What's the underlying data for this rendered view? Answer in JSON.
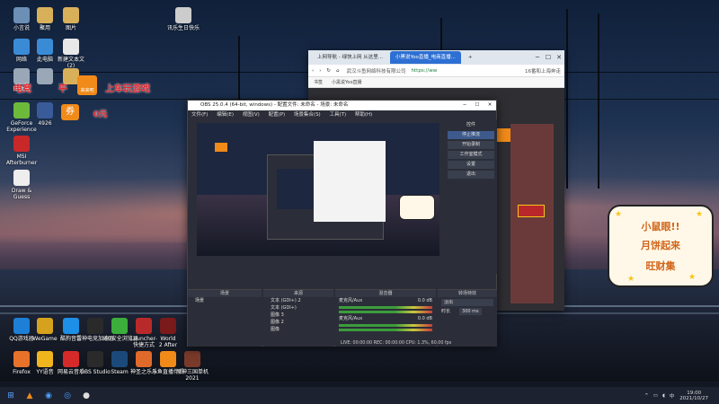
{
  "desktop": {
    "icons": [
      {
        "label": "小言说",
        "color": "#6b8fb5"
      },
      {
        "label": "聚用",
        "color": "#d8b05a"
      },
      {
        "label": "图片",
        "color": "#d8b05a"
      },
      {
        "label": "网络",
        "color": "#3a8bd6"
      },
      {
        "label": "此电脑",
        "color": "#3a8bd6"
      },
      {
        "label": "新建文本文\n(2)",
        "color": "#e8e8e8"
      },
      {
        "label": "回收站",
        "color": "#9aa7b6"
      },
      {
        "label": "",
        "color": "#9aa7b6"
      },
      {
        "label": "",
        "color": "#d8b05a"
      },
      {
        "label": "GeForce\nExperience",
        "color": "#6dba3a"
      },
      {
        "label": "4926",
        "color": "#3a5b9a"
      },
      {
        "label": "MSI\nAfterburner",
        "color": "#c82828"
      },
      {
        "label": "Draw &\nGuess",
        "color": "#eeeeee"
      },
      {
        "label": "QQ游戏器",
        "color": "#1e7fd6"
      },
      {
        "label": "WeGame",
        "color": "#d6a21e"
      },
      {
        "label": "酷狗音乐",
        "color": "#1e8fe6"
      },
      {
        "label": "雷神电竞加速器",
        "color": "#2a2a2a"
      },
      {
        "label": "360安全浏览器",
        "color": "#3bae3b"
      },
      {
        "label": "Launcher-\n快捷方式",
        "color": "#b82a2a"
      },
      {
        "label": "World\n2 After",
        "color": "#7a1a1a"
      },
      {
        "label": "Firefox",
        "color": "#e8722a"
      },
      {
        "label": "YY语音",
        "color": "#f0b51e"
      },
      {
        "label": "网易云音乐",
        "color": "#d62a2a"
      },
      {
        "label": "OBS Studio",
        "color": "#2a2a2a"
      },
      {
        "label": "Steam",
        "color": "#1b4a7a"
      },
      {
        "label": "神圣之乐乐",
        "color": "#e06a2a"
      },
      {
        "label": "斗鱼直播伴侣",
        "color": "#f08a19"
      },
      {
        "label": "原神三国单机\n2021",
        "color": "#7a3a2a"
      },
      {
        "label": "讯乐生日快乐",
        "color": "#cccccc"
      }
    ]
  },
  "overlay": {
    "line1_left": "电竞",
    "line1_mid": "平",
    "line1_right": "上车玩游戏",
    "badge_label": "来来吧",
    "coupon": "券",
    "coupon_suffix": "0元"
  },
  "browser": {
    "tabs": [
      {
        "label": "上网导航 - 绿快上网 从这里..."
      },
      {
        "label": "小黑说Yoo直播_电商直播..."
      }
    ],
    "new_tab": "+",
    "address": "https://ww",
    "address_prefix": "武汉斗鱼网络科技有限公司",
    "ext_text": "16番和上海奔走",
    "bookmarks": [
      "书签",
      "小黑说Yoo直播"
    ],
    "controls": [
      "─",
      "☐",
      "✕"
    ]
  },
  "obs": {
    "title": "OBS 25.0.4 (64-bit, windows) - 配置文件: 未命名 - 场景: 未命名",
    "menu": [
      "文件(F)",
      "编辑(E)",
      "视图(V)",
      "配置(P)",
      "场景集合(S)",
      "工具(T)",
      "帮助(H)"
    ],
    "side_buttons": [
      "控件",
      "停止推流",
      "开始录制",
      "工作室模式",
      "设置",
      "退出"
    ],
    "docks": {
      "scenes": {
        "header": "场景",
        "items": [
          "场景"
        ]
      },
      "sources": {
        "header": "来源",
        "items": [
          "文本 (GDI+) 2",
          "文本 (GDI+)",
          "图像 3",
          "图像 2",
          "图像"
        ]
      },
      "mixer": {
        "header": "混音器",
        "tracks": [
          {
            "name": "麦克风/Aux",
            "value": "0.0 dB"
          },
          {
            "name": "麦克风/Aux",
            "value": "0.0 dB"
          }
        ]
      },
      "transitions": {
        "header": "转场特效",
        "fade": "淡出",
        "duration_label": "时长",
        "duration_value": "300 ms"
      }
    },
    "status": "LIVE: 00:00:00   REC: 00:00:00   CPU: 1.3%, 60.00 fps"
  },
  "promo": {
    "line1": "小鼠眼!!",
    "line2": "月饼起来",
    "line3": "旺财集"
  },
  "taskbar": {
    "time": "19:00",
    "date": "2021/10/27",
    "tray_icons": [
      "chevron-up",
      "network",
      "speaker",
      "ime"
    ]
  }
}
